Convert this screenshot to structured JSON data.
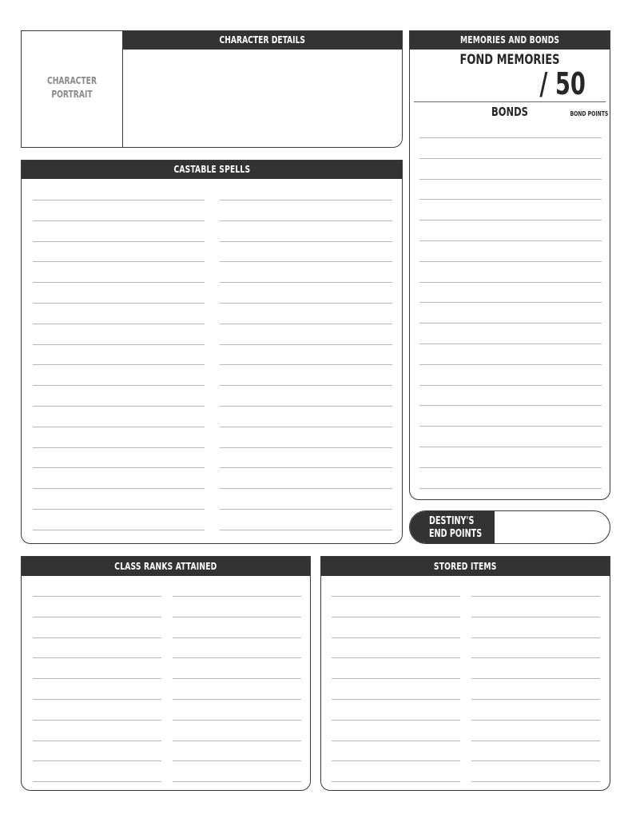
{
  "character_details": {
    "portrait_label_line1": "CHARACTER",
    "portrait_label_line2": "PORTRAIT",
    "header": "CHARACTER DETAILS"
  },
  "memories": {
    "header": "MEMORIES AND BONDS",
    "fond_memories_label": "FOND MEMORIES",
    "fond_memories_max": "/ 50",
    "bonds_label": "BONDS",
    "bond_points_label": "BOND POINTS"
  },
  "spells": {
    "header": "CASTABLE SPELLS"
  },
  "destiny": {
    "line1": "DESTINY'S",
    "line2": "END POINTS"
  },
  "class_ranks": {
    "header": "CLASS RANKS ATTAINED"
  },
  "stored_items": {
    "header": "STORED ITEMS"
  },
  "colors": {
    "header_bg": "#333333",
    "border": "#3a3a3a",
    "rule": "#b9b9b9"
  }
}
